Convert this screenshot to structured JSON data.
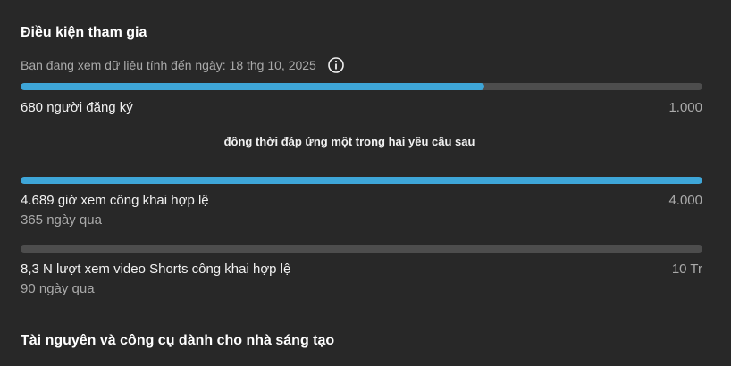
{
  "section_title": "Điều kiện tham gia",
  "data_note": "Bạn đang xem dữ liệu tính đến ngày: 18 thg 10, 2025",
  "info_icon": "info-icon",
  "subscribers": {
    "label": "680 người đăng ký",
    "target": "1.000",
    "progress": 0.68
  },
  "either_note": "đồng thời đáp ứng một trong hai yêu cầu sau",
  "watch_hours": {
    "label": "4.689 giờ xem công khai hợp lệ",
    "target": "4.000",
    "period": "365 ngày qua",
    "progress": 1.0
  },
  "shorts_views": {
    "label": "8,3 N lượt xem video Shorts công khai hợp lệ",
    "target": "10 Tr",
    "period": "90 ngày qua",
    "progress": 0.0
  },
  "resources_title": "Tài nguyên và công cụ dành cho nhà sáng tạo",
  "colors": {
    "background": "#282828",
    "bar_track": "#4d4d4d",
    "bar_fill": "#3ea6d8"
  }
}
